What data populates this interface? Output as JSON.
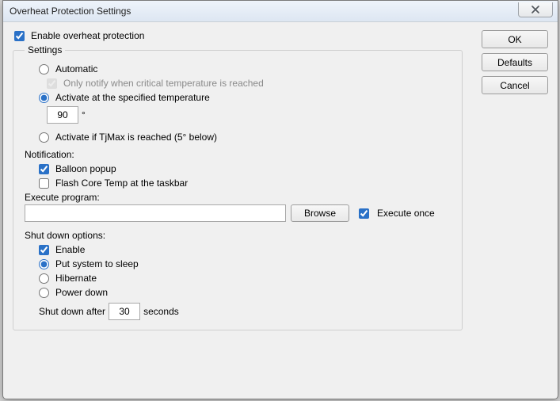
{
  "title": "Overheat Protection Settings",
  "enable_label": "Enable overheat protection",
  "enable_checked": true,
  "settings_legend": "Settings",
  "mode": {
    "automatic_label": "Automatic",
    "automatic_selected": false,
    "only_notify_label": "Only notify when critical temperature is reached",
    "only_notify_checked": true,
    "at_temp_label": "Activate at the specified temperature",
    "at_temp_selected": true,
    "temperature_value": "90",
    "degree_symbol": "°",
    "tjmax_label": "Activate if TjMax is reached (5° below)",
    "tjmax_selected": false
  },
  "notification": {
    "heading": "Notification:",
    "balloon_label": "Balloon popup",
    "balloon_checked": true,
    "flash_label": "Flash Core Temp at the taskbar",
    "flash_checked": false,
    "execute_heading": "Execute program:",
    "execute_path": "",
    "browse_label": "Browse",
    "execute_once_label": "Execute once",
    "execute_once_checked": true
  },
  "shutdown": {
    "heading": "Shut down options:",
    "enable_label": "Enable",
    "enable_checked": true,
    "sleep_label": "Put system to sleep",
    "sleep_selected": true,
    "hibernate_label": "Hibernate",
    "hibernate_selected": false,
    "powerdown_label": "Power down",
    "powerdown_selected": false,
    "after_label": "Shut down after",
    "after_value": "30",
    "after_unit": "seconds"
  },
  "buttons": {
    "ok": "OK",
    "defaults": "Defaults",
    "cancel": "Cancel"
  }
}
